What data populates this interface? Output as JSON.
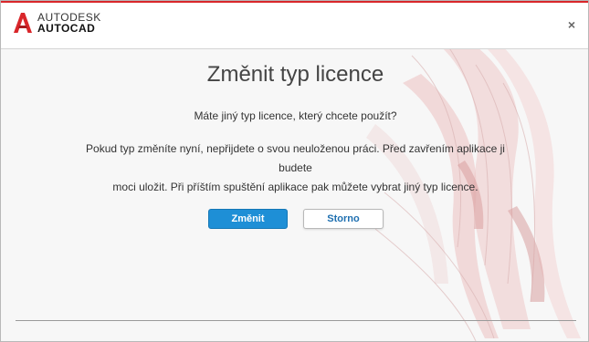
{
  "brand": {
    "line1": "AUTODESK",
    "line2": "AUTOCAD",
    "logo_icon": "autocad-a-icon",
    "accent_color": "#d9262a"
  },
  "window": {
    "close_symbol": "×",
    "close_icon": "close-icon"
  },
  "dialog": {
    "title": "Změnit typ licence",
    "question": "Máte jiný typ licence, který chcete použít?",
    "body_line1": "Pokud typ změníte nyní, nepřijdete o svou neuloženou práci. Před zavřením aplikace ji budete",
    "body_line2": "moci uložit. Při příštím spuštění aplikace pak můžete vybrat jiný typ licence."
  },
  "buttons": {
    "primary_label": "Změnit",
    "secondary_label": "Storno",
    "primary_color": "#1e8fd6"
  }
}
